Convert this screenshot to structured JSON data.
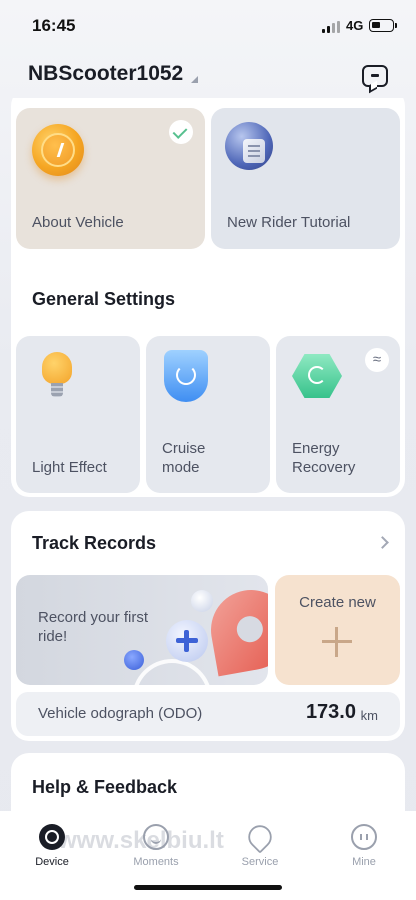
{
  "status_bar": {
    "time": "16:45",
    "network": "4G"
  },
  "header": {
    "device_name": "NBScooter1052"
  },
  "top_tiles": [
    {
      "label": "About Vehicle",
      "checked": true,
      "icon": "scooter-coin-icon"
    },
    {
      "label": "New Rider Tutorial",
      "icon": "tutorial-document-icon"
    }
  ],
  "general_settings": {
    "title": "General Settings",
    "items": [
      {
        "label": "Light Effect",
        "icon": "light-bulb-icon"
      },
      {
        "label": "Cruise mode",
        "icon": "cruise-shield-icon"
      },
      {
        "label": "Energy Recovery",
        "icon": "energy-recycle-icon",
        "badge_icon": "wave-icon"
      }
    ]
  },
  "track_records": {
    "title": "Track Records",
    "record_prompt": "Record your first ride!",
    "create_label": "Create new",
    "odo_label": "Vehicle odograph (ODO)",
    "odo_value": "173.0",
    "odo_unit": "km"
  },
  "help": {
    "title": "Help & Feedback"
  },
  "tabbar": {
    "watermark": "www.skelbiu.lt",
    "tabs": [
      {
        "label": "Device",
        "active": true
      },
      {
        "label": "Moments"
      },
      {
        "label": "Service"
      },
      {
        "label": "Mine"
      }
    ]
  },
  "colors": {
    "about_tile": "#e8e2db",
    "create_tile": "#f6e2cf",
    "check": "#57c08f",
    "text_primary": "#1a1d26"
  }
}
